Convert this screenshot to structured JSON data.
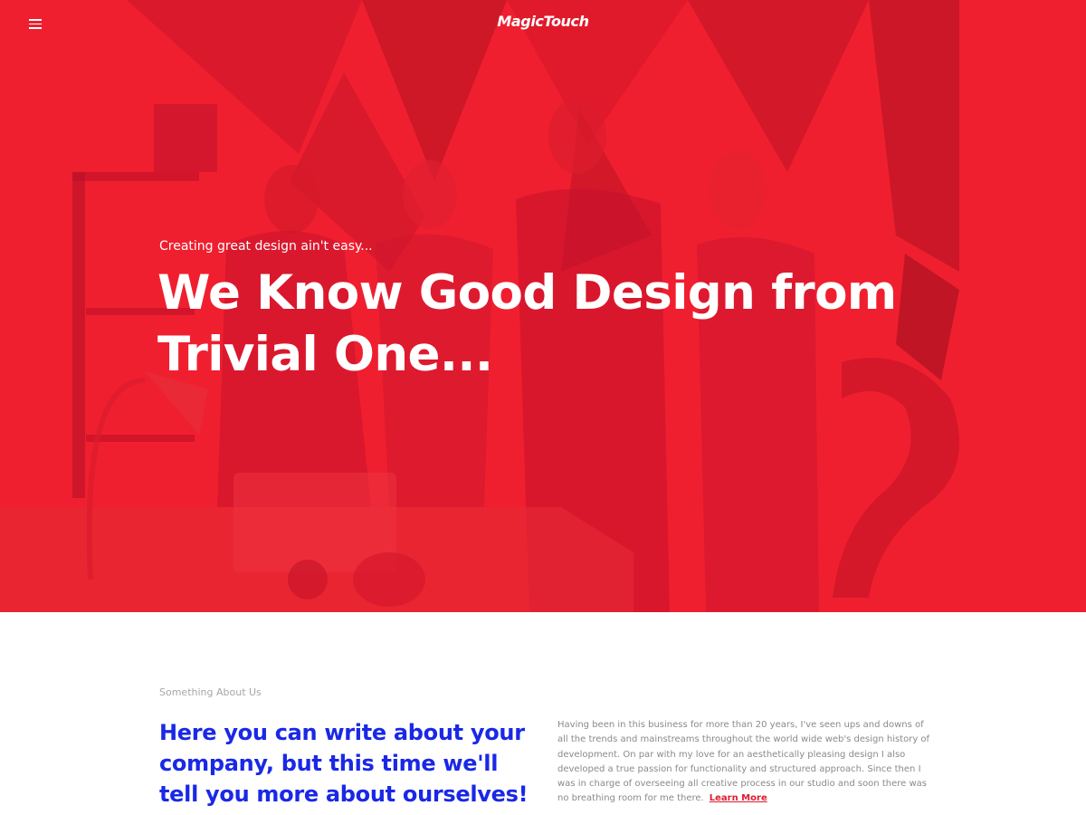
{
  "header": {
    "logo": "MagicTouch",
    "menu_icon": "hamburger-menu-icon"
  },
  "hero": {
    "subtitle": "Creating great design ain't easy...",
    "title": "We Know Good Design from Trivial One...",
    "background_color": "#f01f2f"
  },
  "about": {
    "label": "Something About Us",
    "heading": "Here you can write about your company, but this time we'll tell you more about ourselves!",
    "body": "Having been in this business for more than 20 years, I've seen ups and downs of all the trends and mainstreams throughout the world wide web's design history of development. On par with my love for an aesthetically pleasing design I also developed a true passion for functionality and structured approach. Since then I was in charge of overseeing all creative process in our studio and soon there was no breathing room for me there.",
    "link_label": "Learn More",
    "heading_color": "#1a28e6",
    "link_color": "#e01b2e"
  }
}
